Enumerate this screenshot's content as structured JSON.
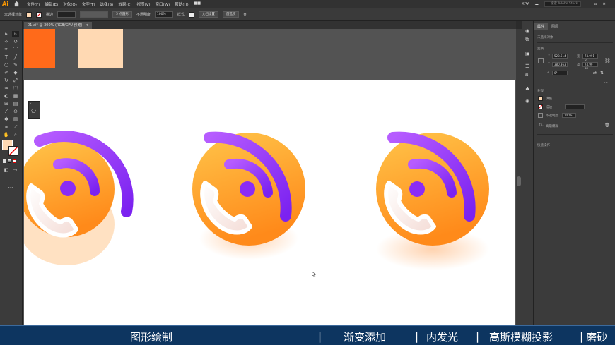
{
  "app": {
    "logo": "Ai",
    "workspace": "XPY",
    "search_placeholder": "搜索 Adobe Stock"
  },
  "menu": [
    "文件(F)",
    "编辑(E)",
    "对象(O)",
    "文字(T)",
    "选择(S)",
    "效果(C)",
    "视图(V)",
    "窗口(W)",
    "帮助(H)"
  ],
  "layout_menu": "■■",
  "control": {
    "selection": "未选择对象",
    "stroke_label": "描边",
    "stroke_width": "",
    "brush": "5 点圆形",
    "opacity_label": "不透明度",
    "opacity_value": "100%",
    "style_label": "样式",
    "doc_setup": "文档设置",
    "prefs": "首选项"
  },
  "document_tab": {
    "title": "01.ai* @ 300% (RGB/GPU 预览)",
    "close": "×"
  },
  "panel": {
    "tabs": [
      "属性",
      "图层"
    ],
    "no_selection": "未选择对象",
    "transform_title": "变换",
    "x_label": "X",
    "x_value": "528.614",
    "y_label": "Y",
    "y_value": "380.363",
    "w_label": "宽",
    "w_value": "74.991 p",
    "h_label": "高",
    "h_value": "74.99 px",
    "angle_value": "0°",
    "appearance_title": "外观",
    "fill_label": "填色",
    "stroke_label": "描边",
    "opacity_label": "不透明度",
    "opacity_value": "100%",
    "fx_label": "高斯模糊",
    "quick_actions": "快速操作"
  },
  "bottom_captions": [
    "图形绘制",
    "渐变添加",
    "内发光",
    "高斯模糊投影",
    "磨砂"
  ],
  "colors": {
    "accent_orange": "#ff6a1a",
    "peach": "#ffd9b3",
    "purple": "#8b2cf5",
    "orange": "#ffa12a",
    "caption_bg": "#0d3560"
  }
}
